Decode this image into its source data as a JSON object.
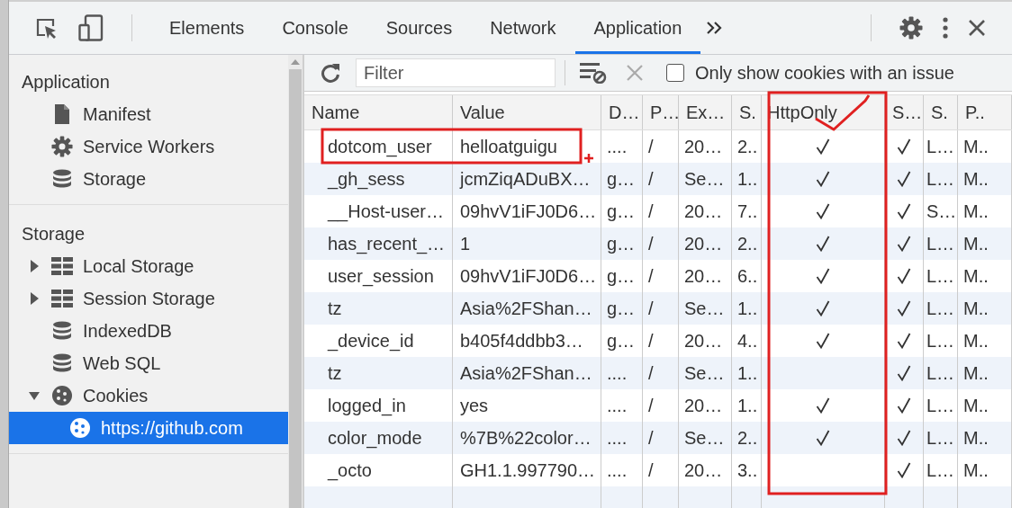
{
  "tabs": [
    {
      "label": "Elements",
      "selected": false
    },
    {
      "label": "Console",
      "selected": false
    },
    {
      "label": "Sources",
      "selected": false
    },
    {
      "label": "Network",
      "selected": false
    },
    {
      "label": "Application",
      "selected": true
    }
  ],
  "sidebar": {
    "sections": [
      {
        "title": "Application",
        "items": [
          {
            "label": "Manifest",
            "kind": "file",
            "selected": false
          },
          {
            "label": "Service Workers",
            "kind": "gear",
            "selected": false
          },
          {
            "label": "Storage",
            "kind": "database",
            "selected": false
          }
        ]
      },
      {
        "title": "Storage",
        "items": [
          {
            "label": "Local Storage",
            "kind": "grid",
            "expanded": false,
            "selected": false
          },
          {
            "label": "Session Storage",
            "kind": "grid",
            "expanded": false,
            "selected": false
          },
          {
            "label": "IndexedDB",
            "kind": "database",
            "selected": false
          },
          {
            "label": "Web SQL",
            "kind": "database",
            "selected": false
          },
          {
            "label": "Cookies",
            "kind": "cookie",
            "expanded": true,
            "selected": false,
            "children": [
              {
                "label": "https://github.com",
                "kind": "cookie",
                "selected": true
              }
            ]
          }
        ]
      }
    ]
  },
  "toolbar": {
    "filter": {
      "placeholder": "Filter"
    },
    "issue_filter": {
      "label": "Only show cookies with an issue",
      "checked": false
    }
  },
  "table": {
    "columns": [
      "Name",
      "Value",
      "D…",
      "P…",
      "Ex…",
      "S.",
      "HttpOnly",
      "S…",
      "S.",
      "P.."
    ],
    "rows": [
      {
        "name": "dotcom_user",
        "value": "helloatguigu",
        "domain": "....",
        "path": "/",
        "expires": "20…",
        "size": "2..",
        "http_only": true,
        "secure": true,
        "same_site": "L…",
        "priority": "M.."
      },
      {
        "name": "_gh_sess",
        "value": "jcmZiqADuBX…",
        "domain": "g…",
        "path": "/",
        "expires": "Se…",
        "size": "1..",
        "http_only": true,
        "secure": true,
        "same_site": "L…",
        "priority": "M.."
      },
      {
        "name": "__Host-user…",
        "value": "09hvV1iFJ0D6…",
        "domain": "g…",
        "path": "/",
        "expires": "20…",
        "size": "7..",
        "http_only": true,
        "secure": true,
        "same_site": "S…",
        "priority": "M.."
      },
      {
        "name": "has_recent_…",
        "value": "1",
        "domain": "g…",
        "path": "/",
        "expires": "20…",
        "size": "2..",
        "http_only": true,
        "secure": true,
        "same_site": "L…",
        "priority": "M.."
      },
      {
        "name": "user_session",
        "value": "09hvV1iFJ0D6…",
        "domain": "g…",
        "path": "/",
        "expires": "20…",
        "size": "6..",
        "http_only": true,
        "secure": true,
        "same_site": "L…",
        "priority": "M.."
      },
      {
        "name": "tz",
        "value": "Asia%2FShan…",
        "domain": "g…",
        "path": "/",
        "expires": "Se…",
        "size": "1..",
        "http_only": true,
        "secure": true,
        "same_site": "L…",
        "priority": "M.."
      },
      {
        "name": "_device_id",
        "value": "b405f4ddbb3…",
        "domain": "g…",
        "path": "/",
        "expires": "20…",
        "size": "4..",
        "http_only": true,
        "secure": true,
        "same_site": "L…",
        "priority": "M.."
      },
      {
        "name": "tz",
        "value": "Asia%2FShan…",
        "domain": "....",
        "path": "/",
        "expires": "Se…",
        "size": "1..",
        "http_only": false,
        "secure": true,
        "same_site": "L…",
        "priority": "M.."
      },
      {
        "name": "logged_in",
        "value": "yes",
        "domain": "....",
        "path": "/",
        "expires": "20…",
        "size": "1..",
        "http_only": true,
        "secure": true,
        "same_site": "L…",
        "priority": "M.."
      },
      {
        "name": "color_mode",
        "value": "%7B%22color…",
        "domain": "....",
        "path": "/",
        "expires": "Se…",
        "size": "2..",
        "http_only": true,
        "secure": true,
        "same_site": "L…",
        "priority": "M.."
      },
      {
        "name": "_octo",
        "value": "GH1.1.997790…",
        "domain": "....",
        "path": "/",
        "expires": "20…",
        "size": "3..",
        "http_only": false,
        "secure": true,
        "same_site": "L…",
        "priority": "M.."
      }
    ]
  }
}
